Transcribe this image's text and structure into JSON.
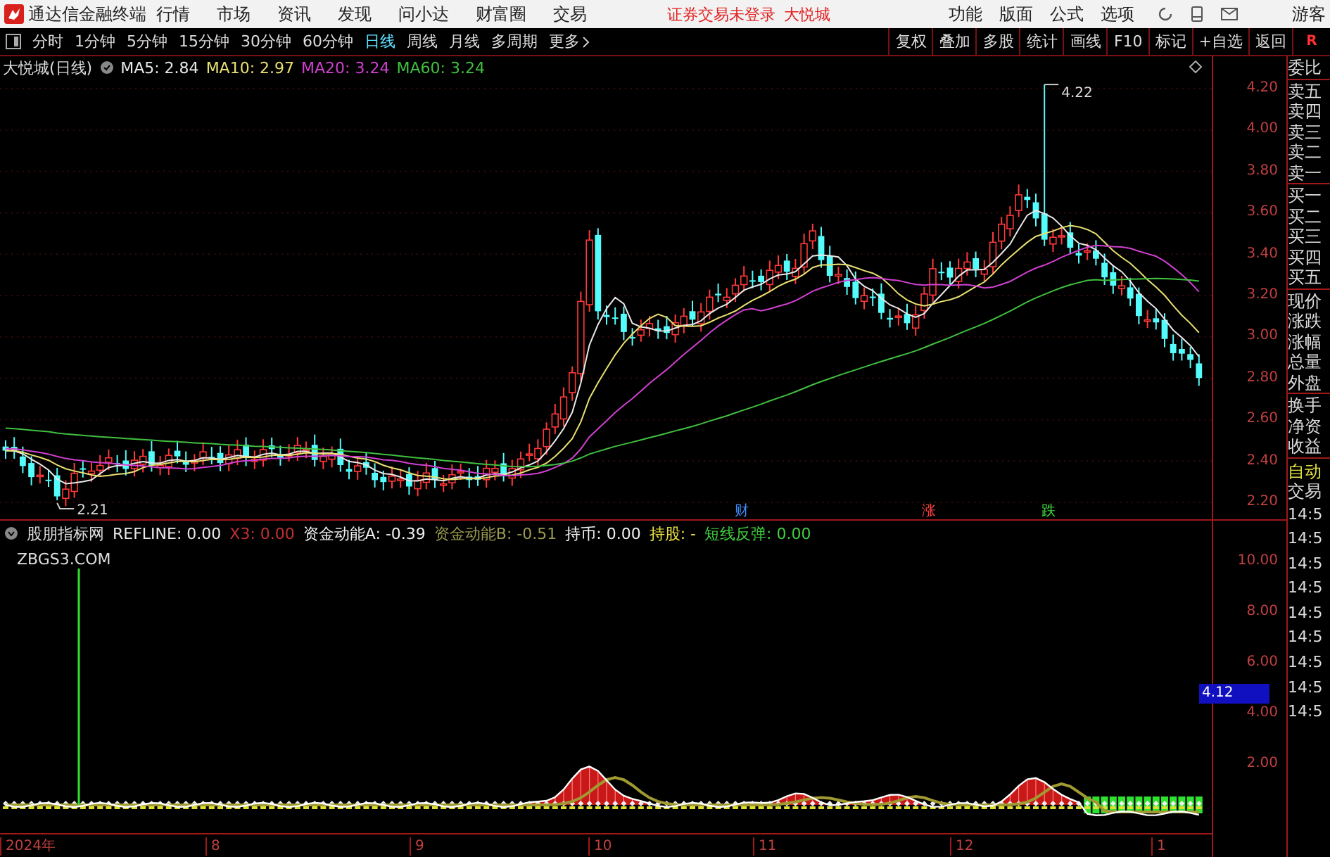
{
  "app": {
    "title": "通达信金融终端",
    "menus": [
      "行情",
      "市场",
      "资讯",
      "发现",
      "问小达",
      "财富圈",
      "交易"
    ],
    "notice": "证券交易未登录",
    "stock": "大悦城",
    "right_menus": [
      "功能",
      "版面",
      "公式",
      "选项"
    ],
    "user": "游客"
  },
  "period_tabs": [
    {
      "label": "分时",
      "selected": false
    },
    {
      "label": "1分钟",
      "selected": false
    },
    {
      "label": "5分钟",
      "selected": false
    },
    {
      "label": "15分钟",
      "selected": false
    },
    {
      "label": "30分钟",
      "selected": false
    },
    {
      "label": "60分钟",
      "selected": false
    },
    {
      "label": "日线",
      "selected": true
    },
    {
      "label": "周线",
      "selected": false
    },
    {
      "label": "月线",
      "selected": false
    },
    {
      "label": "多周期",
      "selected": false
    },
    {
      "label": "更多",
      "selected": false
    }
  ],
  "tools": [
    "复权",
    "叠加",
    "多股",
    "统计",
    "画线",
    "F10",
    "标记",
    "+自选",
    "返回"
  ],
  "corner": "R",
  "price_chart": {
    "title": "大悦城(日线)",
    "ma": [
      {
        "label": "MA5: 2.84",
        "color": "#e8e8e8"
      },
      {
        "label": "MA10: 2.97",
        "color": "#e8e070"
      },
      {
        "label": "MA20: 3.24",
        "color": "#d040d0"
      },
      {
        "label": "MA60: 3.24",
        "color": "#40c040"
      }
    ],
    "high_label": "4.22",
    "low_label": "2.21",
    "markers": [
      {
        "text": "财",
        "color": "#4090ff"
      },
      {
        "text": "涨",
        "color": "#ff4040"
      },
      {
        "text": "跌",
        "color": "#40e040"
      }
    ],
    "yticks": [
      "4.20",
      "4.00",
      "3.80",
      "3.60",
      "3.40",
      "3.20",
      "3.00",
      "2.80",
      "2.60",
      "2.40",
      "2.20"
    ]
  },
  "indicator": {
    "name": "股朋指标网",
    "values": [
      {
        "label": "REFLINE: 0.00",
        "color": "#e8e8e8"
      },
      {
        "label": "X3: 0.00",
        "color": "#c03030"
      },
      {
        "label": "资金动能A: -0.39",
        "color": "#f0f0f0"
      },
      {
        "label": "资金动能B: -0.51",
        "color": "#9a9a50"
      },
      {
        "label": "持币: 0.00",
        "color": "#f0f0f0"
      },
      {
        "label": "持股: -",
        "color": "#e8e040"
      },
      {
        "label": "短线反弹: 0.00",
        "color": "#40d040"
      }
    ],
    "site": "ZBGS3.COM",
    "yticks": [
      "10.00",
      "8.00",
      "6.00",
      "4.00",
      "2.00"
    ],
    "cursor_value": "4.12"
  },
  "date_axis": [
    "2024年",
    "8",
    "9",
    "10",
    "11",
    "12",
    "1"
  ],
  "side_panel": {
    "quote_groups": [
      [
        "委比"
      ],
      [
        "卖五",
        "卖四",
        "卖三",
        "卖二",
        "卖一"
      ],
      [
        "买一",
        "买二",
        "买三",
        "买四",
        "买五"
      ],
      [
        "现价",
        "涨跌",
        "涨幅",
        "总量",
        "外盘"
      ],
      [
        "换手",
        "净资",
        "收益"
      ]
    ],
    "auto": "自动",
    "trade": "交易",
    "times": [
      "14:5",
      "14:5",
      "14:5",
      "14:5",
      "14:5",
      "14:5",
      "14:5",
      "14:5",
      "14:5"
    ]
  }
}
